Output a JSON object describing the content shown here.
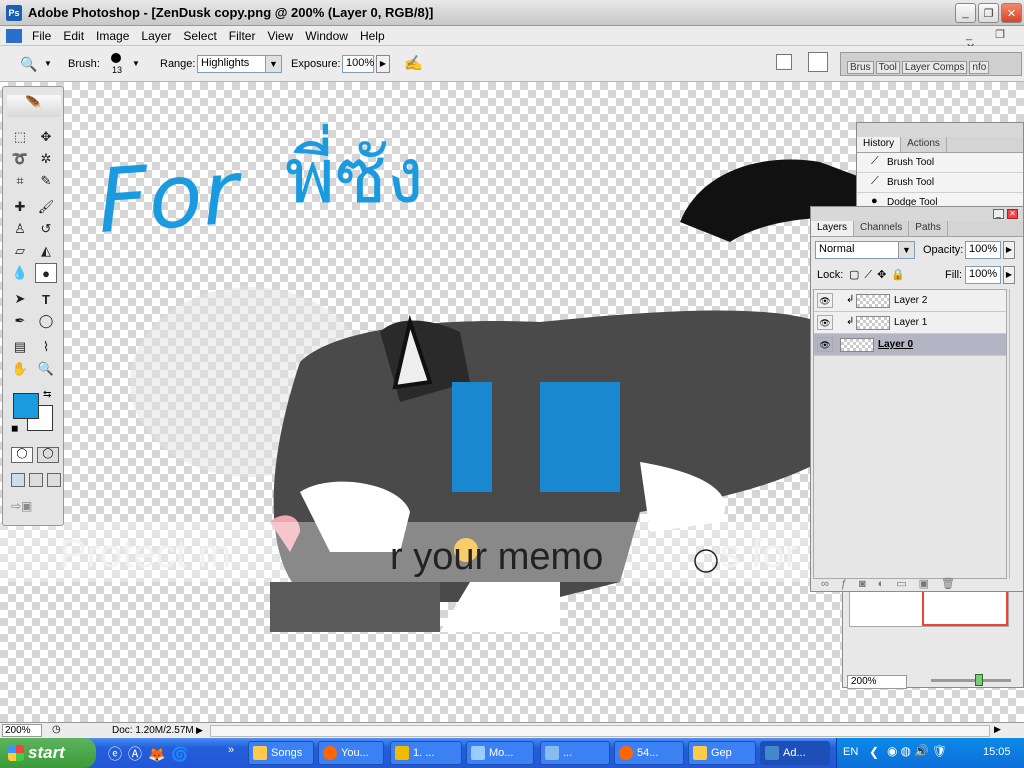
{
  "window": {
    "title": "Adobe Photoshop - [ZenDusk copy.png @ 200% (Layer 0, RGB/8)]",
    "minimize_icon": "_",
    "restore_icon": "❐",
    "close_icon": "✕"
  },
  "menu": [
    "File",
    "Edit",
    "Image",
    "Layer",
    "Select",
    "Filter",
    "View",
    "Window",
    "Help"
  ],
  "options": {
    "brush_label": "Brush:",
    "brush_size": "13",
    "range_label": "Range:",
    "range_value": "Highlights",
    "exposure_label": "Exposure:",
    "exposure_value": "100%"
  },
  "palette_well_tabs": [
    "Brus",
    "Tool",
    "Layer Comps",
    "nfo"
  ],
  "canvas_art": {
    "handwriting_en": "For",
    "handwriting_th": "พี่ซัง",
    "watermark": "photobucket",
    "watermark_tag_left": "Protect m",
    "watermark_tag_mid": "r your memo",
    "watermark_tag_right": "s for less!"
  },
  "history": {
    "tabs": [
      "History",
      "Actions"
    ],
    "items": [
      "Brush Tool",
      "Brush Tool",
      "Dodge Tool"
    ]
  },
  "layers": {
    "tabs": [
      "Layers",
      "Channels",
      "Paths"
    ],
    "blend_mode": "Normal",
    "opacity_label": "Opacity:",
    "opacity_value": "100%",
    "lock_label": "Lock:",
    "fill_label": "Fill:",
    "fill_value": "100%",
    "rows": [
      {
        "name": "Layer 2",
        "active": false
      },
      {
        "name": "Layer 1",
        "active": false
      },
      {
        "name": "Layer 0",
        "active": true
      }
    ]
  },
  "navigator": {
    "zoom": "200%"
  },
  "status": {
    "zoom": "200%",
    "doc": "Doc: 1.20M/2.57M"
  },
  "taskbar": {
    "start_label": "start",
    "tasks": [
      "Songs",
      "You...",
      "1. ...",
      "Mo...",
      "...",
      "54...",
      "Gep",
      "Ad..."
    ],
    "language": "EN",
    "time": "15:05"
  },
  "colors": {
    "foreground": "#1a9be0",
    "background": "#ffffff",
    "accent_blue": "#1a9be0"
  }
}
